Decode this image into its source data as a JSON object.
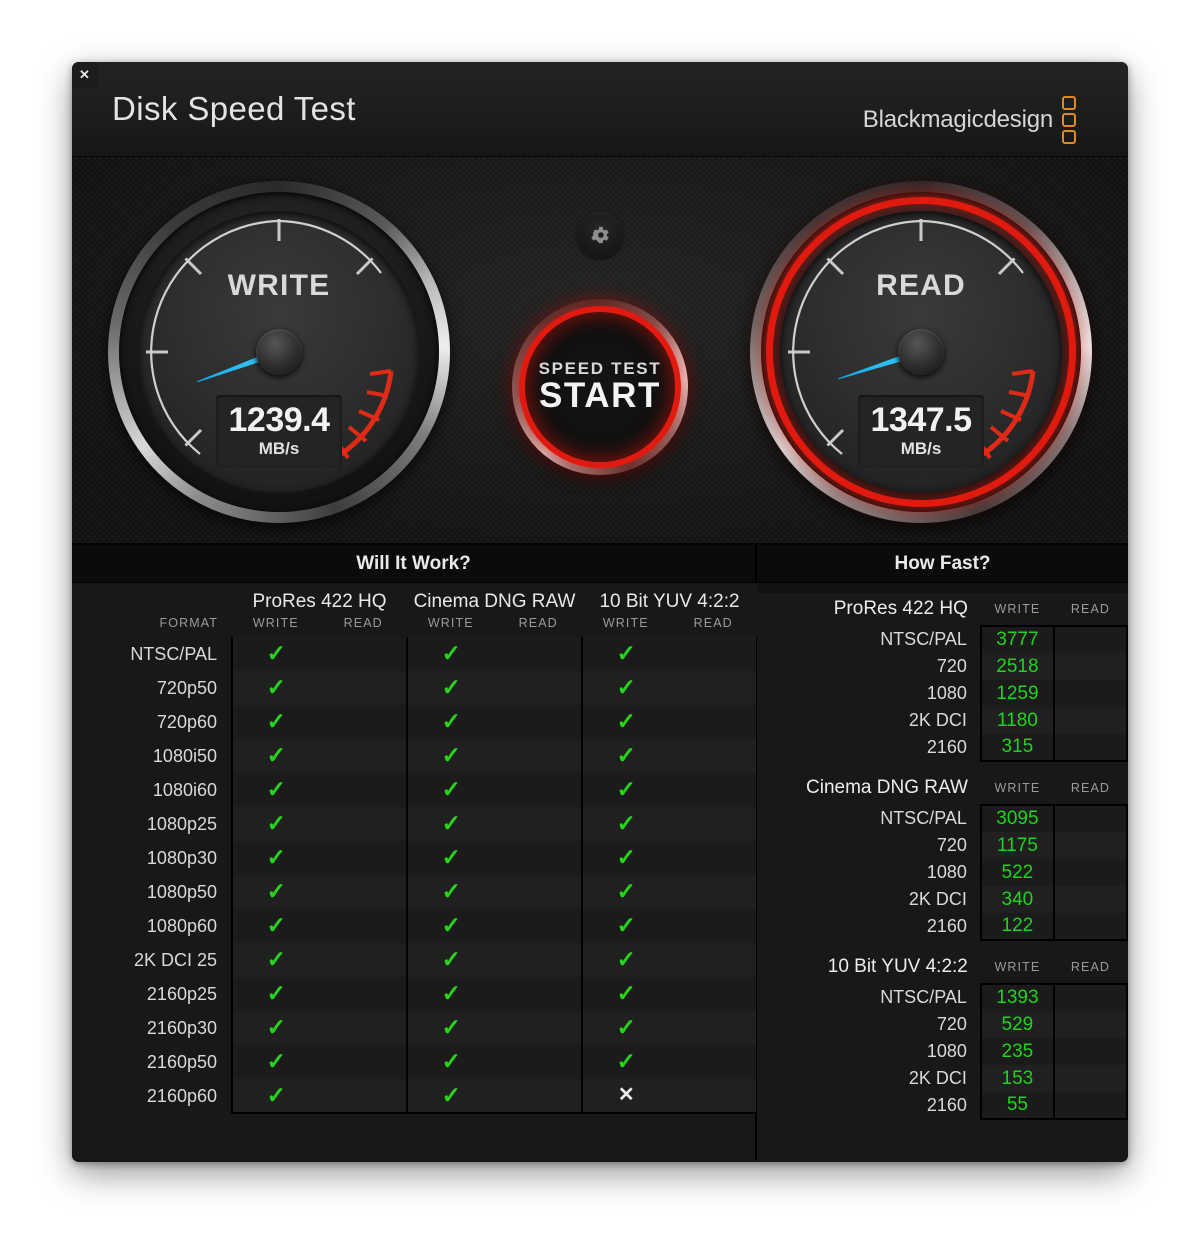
{
  "window": {
    "title": "Disk Speed Test",
    "close_label": "✕",
    "brand": "Blackmagicdesign"
  },
  "gauges": {
    "write": {
      "label": "WRITE",
      "value": "1239.4",
      "unit": "MB/s",
      "needle_angle": -20,
      "active": false
    },
    "read": {
      "label": "READ",
      "value": "1347.5",
      "unit": "MB/s",
      "needle_angle": -18,
      "active": true
    }
  },
  "start_button": {
    "line1": "SPEED TEST",
    "line2": "START"
  },
  "settings_button": {
    "icon": "gear-icon"
  },
  "colors": {
    "accent_red": "#e01a0f",
    "needle_blue": "#24b6ee",
    "ok_green": "#24d617",
    "value_green": "#1ed41c",
    "brand_orange": "#e0891f"
  },
  "will_it_work": {
    "title": "Will It Work?",
    "format_header": "FORMAT",
    "codecs": [
      "ProRes 422 HQ",
      "Cinema DNG RAW",
      "10 Bit YUV 4:2:2"
    ],
    "sub_headers": [
      "WRITE",
      "READ"
    ],
    "formats": [
      "NTSC/PAL",
      "720p50",
      "720p60",
      "1080i50",
      "1080i60",
      "1080p25",
      "1080p30",
      "1080p50",
      "1080p60",
      "2K DCI 25",
      "2160p25",
      "2160p30",
      "2160p50",
      "2160p60"
    ],
    "rows": [
      {
        "format": "NTSC/PAL",
        "cells": [
          "ok",
          "",
          "ok",
          "",
          "ok",
          ""
        ]
      },
      {
        "format": "720p50",
        "cells": [
          "ok",
          "",
          "ok",
          "",
          "ok",
          ""
        ]
      },
      {
        "format": "720p60",
        "cells": [
          "ok",
          "",
          "ok",
          "",
          "ok",
          ""
        ]
      },
      {
        "format": "1080i50",
        "cells": [
          "ok",
          "",
          "ok",
          "",
          "ok",
          ""
        ]
      },
      {
        "format": "1080i60",
        "cells": [
          "ok",
          "",
          "ok",
          "",
          "ok",
          ""
        ]
      },
      {
        "format": "1080p25",
        "cells": [
          "ok",
          "",
          "ok",
          "",
          "ok",
          ""
        ]
      },
      {
        "format": "1080p30",
        "cells": [
          "ok",
          "",
          "ok",
          "",
          "ok",
          ""
        ]
      },
      {
        "format": "1080p50",
        "cells": [
          "ok",
          "",
          "ok",
          "",
          "ok",
          ""
        ]
      },
      {
        "format": "1080p60",
        "cells": [
          "ok",
          "",
          "ok",
          "",
          "ok",
          ""
        ]
      },
      {
        "format": "2K DCI 25",
        "cells": [
          "ok",
          "",
          "ok",
          "",
          "ok",
          ""
        ]
      },
      {
        "format": "2160p25",
        "cells": [
          "ok",
          "",
          "ok",
          "",
          "ok",
          ""
        ]
      },
      {
        "format": "2160p30",
        "cells": [
          "ok",
          "",
          "ok",
          "",
          "ok",
          ""
        ]
      },
      {
        "format": "2160p50",
        "cells": [
          "ok",
          "",
          "ok",
          "",
          "ok",
          ""
        ]
      },
      {
        "format": "2160p60",
        "cells": [
          "ok",
          "",
          "ok",
          "",
          "no",
          ""
        ]
      }
    ],
    "mark_ok": "✓",
    "mark_no": "✕"
  },
  "how_fast": {
    "title": "How Fast?",
    "sub_headers": [
      "WRITE",
      "READ"
    ],
    "groups": [
      {
        "codec": "ProRes 422 HQ",
        "rows": [
          {
            "label": "NTSC/PAL",
            "write": "3777",
            "read": ""
          },
          {
            "label": "720",
            "write": "2518",
            "read": ""
          },
          {
            "label": "1080",
            "write": "1259",
            "read": ""
          },
          {
            "label": "2K DCI",
            "write": "1180",
            "read": ""
          },
          {
            "label": "2160",
            "write": "315",
            "read": ""
          }
        ]
      },
      {
        "codec": "Cinema DNG RAW",
        "rows": [
          {
            "label": "NTSC/PAL",
            "write": "3095",
            "read": ""
          },
          {
            "label": "720",
            "write": "1175",
            "read": ""
          },
          {
            "label": "1080",
            "write": "522",
            "read": ""
          },
          {
            "label": "2K DCI",
            "write": "340",
            "read": ""
          },
          {
            "label": "2160",
            "write": "122",
            "read": ""
          }
        ]
      },
      {
        "codec": "10 Bit YUV 4:2:2",
        "rows": [
          {
            "label": "NTSC/PAL",
            "write": "1393",
            "read": ""
          },
          {
            "label": "720",
            "write": "529",
            "read": ""
          },
          {
            "label": "1080",
            "write": "235",
            "read": ""
          },
          {
            "label": "2K DCI",
            "write": "153",
            "read": ""
          },
          {
            "label": "2160",
            "write": "55",
            "read": ""
          }
        ]
      }
    ]
  }
}
